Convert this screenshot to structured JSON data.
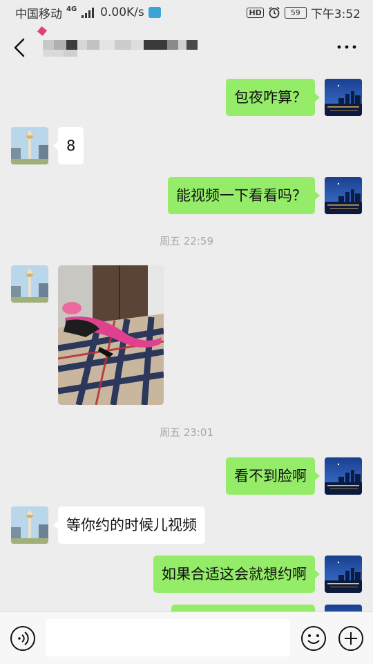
{
  "status": {
    "carrier": "中国移动",
    "network": "4G",
    "speed": "0.00K/s",
    "hd": "HD",
    "battery": "59",
    "time": "下午3:52"
  },
  "header": {
    "back_icon": "chevron-left-icon",
    "more_icon": "more-dots-icon"
  },
  "messages": [
    {
      "text": "包夜咋算？",
      "direction": "outgoing"
    },
    {
      "text": "8",
      "direction": "incoming"
    },
    {
      "text": "能视频一下看看吗？",
      "direction": "outgoing"
    },
    {
      "text": "周五 22:59",
      "direction": "timestamp"
    },
    {
      "text": "",
      "direction": "incoming-image"
    },
    {
      "text": "周五 23:01",
      "direction": "timestamp"
    },
    {
      "text": "看不到脸啊",
      "direction": "outgoing"
    },
    {
      "text": "等你约的时候儿视频",
      "direction": "incoming"
    },
    {
      "text": "如果合适这会就想约啊",
      "direction": "outgoing"
    },
    {
      "text": "",
      "direction": "outgoing"
    }
  ],
  "input": {
    "voice_icon": "voice-icon",
    "emoji_icon": "emoji-icon",
    "plus_icon": "plus-icon"
  },
  "colors": {
    "outgoing_bubble": "#95ec69",
    "incoming_bubble": "#ffffff",
    "background": "#ededed"
  }
}
